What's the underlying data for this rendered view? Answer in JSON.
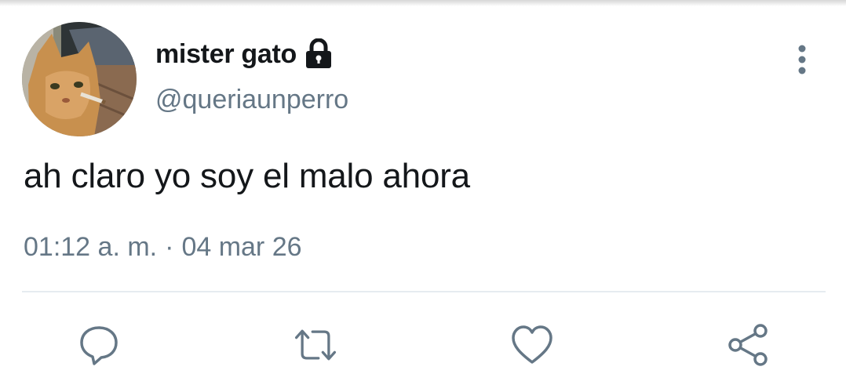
{
  "tweet": {
    "display_name": "mister gato",
    "handle": "@queriaunperro",
    "text": "ah claro yo soy el malo ahora",
    "time": "01:12 a. m.",
    "separator": "·",
    "date": "04 mar 26",
    "protected_icon": "lock-icon",
    "avatar": "cat-smoking-photo"
  },
  "actions": {
    "reply_icon": "speech-bubble-icon",
    "retweet_icon": "retweet-arrows-icon",
    "like_icon": "heart-icon",
    "share_icon": "share-nodes-icon"
  },
  "colors": {
    "text_primary": "#14171a",
    "text_secondary": "#657786",
    "icon": "#657786",
    "divider": "#e6ecf0"
  }
}
